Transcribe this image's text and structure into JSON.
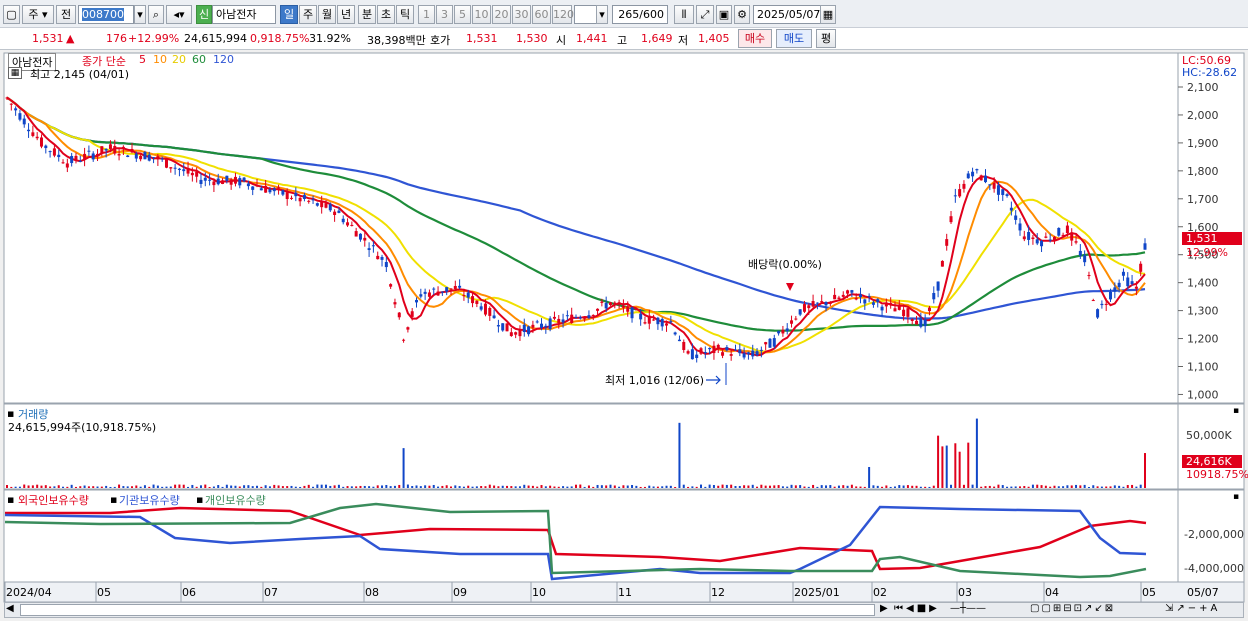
{
  "toolbar": {
    "mode_label": "주",
    "prev_label": "전",
    "code_value": "008700",
    "badge": "신",
    "stock_name": "아남전자",
    "periods": [
      "일",
      "주",
      "월",
      "년",
      "분",
      "초",
      "틱"
    ],
    "active_period": "일",
    "intervals": [
      "1",
      "3",
      "5",
      "10",
      "20",
      "30",
      "60",
      "120"
    ],
    "count_value": "265",
    "count_total": "/600",
    "date_value": "2025/05/07"
  },
  "quote": {
    "price": "1,531",
    "change": "176",
    "change_pct": "+12.99%",
    "volume": "24,615,994",
    "volume_ratio": "0,918.75%",
    "turnover": "31.92%",
    "amount": "38,398백만",
    "hoga_label": "호가",
    "ask": "1,531",
    "bid": "1,530",
    "open_label": "시",
    "open": "1,441",
    "high_label": "고",
    "high": "1,649",
    "low_label": "저",
    "low": "1,405",
    "buy_label": "매수",
    "sell_label": "매도",
    "avg_label": "평"
  },
  "price_panel": {
    "name_label": "아남전자",
    "ma_label": "종가 단순",
    "ma_periods": [
      "5",
      "10",
      "20",
      "60",
      "120"
    ],
    "max_label": "최고 2,145 (04/01)",
    "min_label": "최저 1,016 (12/06)",
    "dividend_label": "배당락(0.00%)",
    "lc_label": "LC:50.69",
    "hc_label": "HC:-28.62",
    "price_tag": "1,531",
    "pct_tag": "12.99%"
  },
  "volume_panel": {
    "title": "거래량",
    "value_label": "24,615,994주(10,918.75%)",
    "axis_label": "50,000K",
    "tag_value": "24,616K",
    "tag_pct": "10918.75%"
  },
  "holding_panel": {
    "legend": [
      "외국인보유수량",
      "기관보유수량",
      "개인보유수량"
    ],
    "axis_labels": [
      "-2,000,000",
      "-4,000,000"
    ]
  },
  "price_axis": [
    "2,100",
    "2,000",
    "1,900",
    "1,800",
    "1,700",
    "1,600",
    "1,500",
    "1,400",
    "1,300",
    "1,200",
    "1,100",
    "1,000"
  ],
  "x_axis": [
    "2024/04",
    "05",
    "06",
    "07",
    "08",
    "09",
    "10",
    "11",
    "12",
    "2025/01",
    "02",
    "03",
    "04",
    "05"
  ],
  "x_axis_end": "05/07",
  "colors": {
    "up": "#e0001b",
    "down": "#1046c8",
    "ma5": "#e0001b",
    "ma10": "#ff8c00",
    "ma20": "#f0e000",
    "ma60": "#1e8c3a",
    "ma120": "#2f55d4",
    "foreign": "#e0001b",
    "institution": "#2f55d4",
    "individual": "#3a8c5c"
  }
}
